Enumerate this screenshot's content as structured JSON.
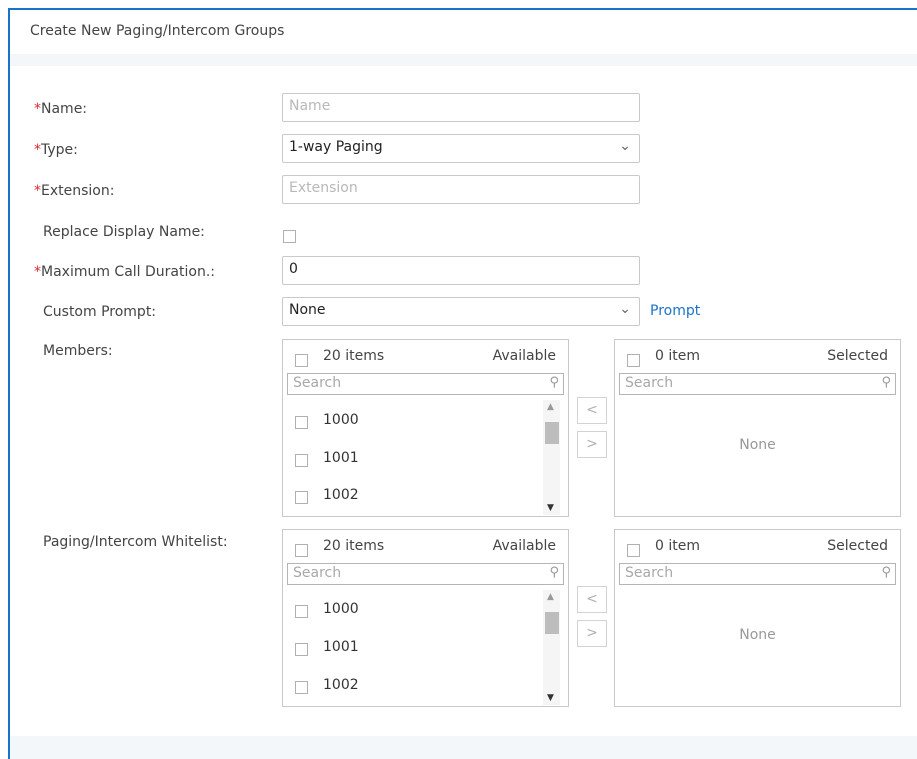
{
  "header": {
    "title": "Create New Paging/Intercom Groups"
  },
  "form": {
    "name": {
      "required_mark": "*",
      "label": "Name:",
      "placeholder": "Name"
    },
    "type": {
      "required_mark": "*",
      "label": "Type:",
      "value": "1-way Paging"
    },
    "extension": {
      "required_mark": "*",
      "label": "Extension:",
      "placeholder": "Extension"
    },
    "replace_display_name": {
      "label": "Replace Display Name:",
      "checked": false
    },
    "max_call_duration": {
      "required_mark": "*",
      "label": "Maximum Call Duration.:",
      "value": "0"
    },
    "custom_prompt": {
      "label": "Custom Prompt:",
      "value": "None",
      "link": "Prompt"
    }
  },
  "members": {
    "label": "Members:",
    "available": {
      "count": "20 items",
      "title": "Available",
      "search_placeholder": "Search",
      "items": [
        "1000",
        "1001",
        "1002"
      ]
    },
    "selected": {
      "count": "0 item",
      "title": "Selected",
      "search_placeholder": "Search",
      "empty": "None"
    }
  },
  "whitelist": {
    "label": "Paging/Intercom Whitelist:",
    "available": {
      "count": "20 items",
      "title": "Available",
      "search_placeholder": "Search",
      "items": [
        "1000",
        "1001",
        "1002"
      ]
    },
    "selected": {
      "count": "0 item",
      "title": "Selected",
      "search_placeholder": "Search",
      "empty": "None"
    }
  },
  "icons": {
    "dropdown": "chevron-down-icon",
    "search": "search-icon",
    "move_left": "chevron-left-icon",
    "move_right": "chevron-right-icon"
  },
  "colors": {
    "accent": "#1a73c9",
    "required": "#d9262c"
  }
}
